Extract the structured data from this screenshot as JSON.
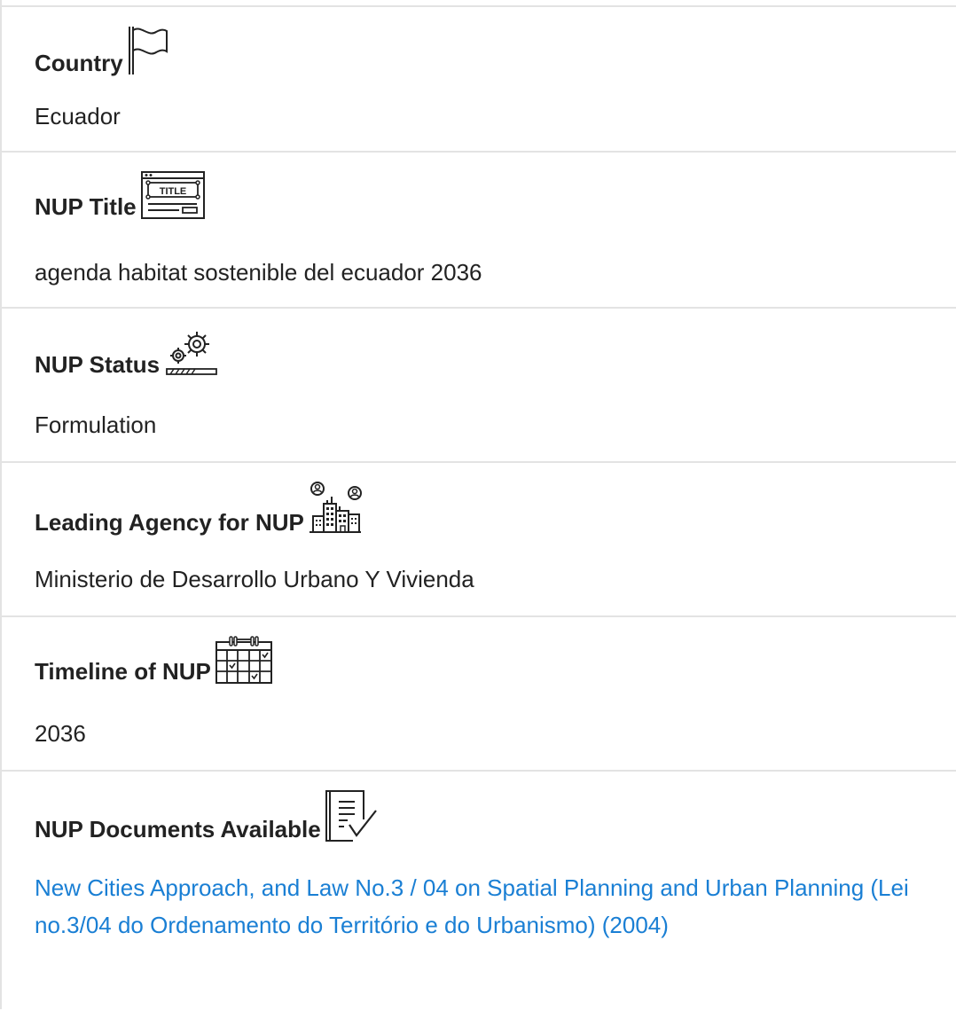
{
  "fields": [
    {
      "label": "Country",
      "value": "Ecuador",
      "icon": "flag-icon"
    },
    {
      "label": "NUP Title",
      "value": "agenda habitat sostenible del ecuador 2036",
      "icon": "title-window-icon"
    },
    {
      "label": "NUP Status",
      "value": "Formulation",
      "icon": "gears-progress-icon"
    },
    {
      "label": "Leading Agency for NUP",
      "value": "Ministerio de Desarrollo Urbano Y Vivienda",
      "icon": "city-buildings-people-icon"
    },
    {
      "label": "Timeline of NUP",
      "value": "2036",
      "icon": "calendar-check-icon"
    },
    {
      "label": "NUP Documents Available",
      "value": "New Cities Approach, and Law No.3 / 04 on Spatial Planning and Urban Planning (Lei no.3/04 do Ordenamento do Território e do Urbanismo) (2004)",
      "icon": "document-check-icon"
    }
  ],
  "colors": {
    "text": "#222222",
    "link": "#1a7fd4",
    "divider": "#e3e3e3"
  }
}
